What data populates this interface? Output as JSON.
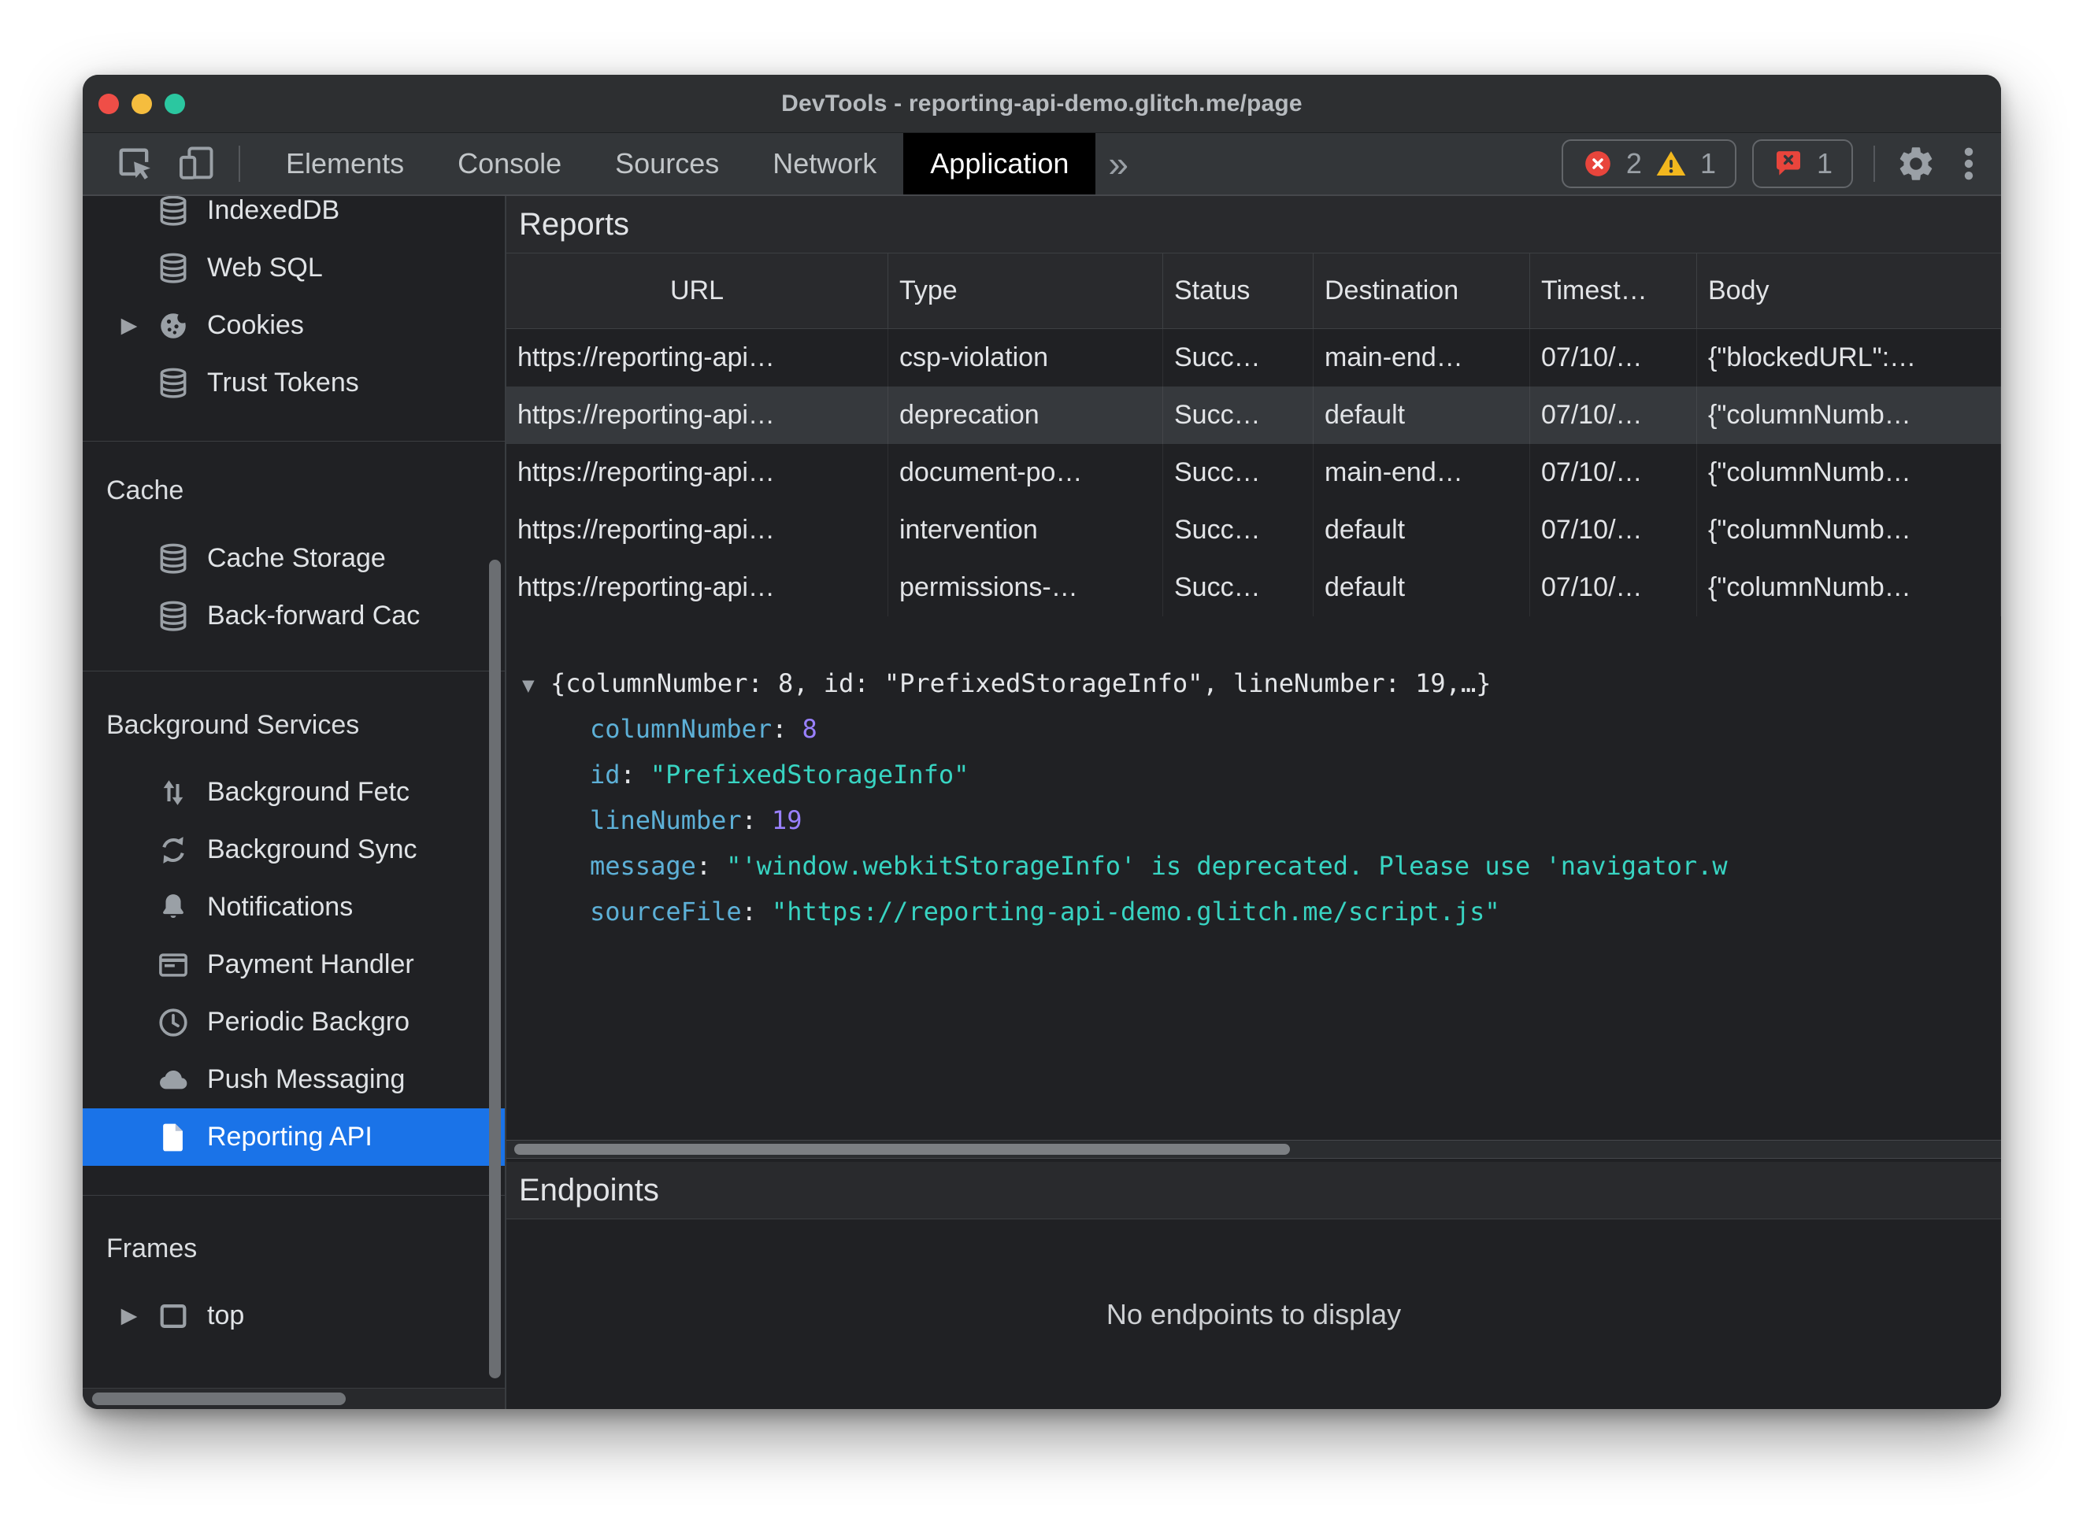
{
  "window": {
    "title": "DevTools - reporting-api-demo.glitch.me/page"
  },
  "toolbar": {
    "tabs": [
      {
        "label": "Elements",
        "selected": false
      },
      {
        "label": "Console",
        "selected": false
      },
      {
        "label": "Sources",
        "selected": false
      },
      {
        "label": "Network",
        "selected": false
      },
      {
        "label": "Application",
        "selected": true
      }
    ],
    "more_tabs_glyph": "»",
    "badges": {
      "errors": "2",
      "warnings": "1",
      "issues": "1"
    }
  },
  "sidebar": {
    "expander_glyph": "▶",
    "items": [
      {
        "label": "IndexedDB",
        "icon": "database-icon"
      },
      {
        "label": "Web SQL",
        "icon": "database-icon"
      },
      {
        "label": "Cookies",
        "icon": "cookie-icon",
        "expander": true
      },
      {
        "label": "Trust Tokens",
        "icon": "database-icon"
      },
      {
        "label": "Cache",
        "type": "section-header"
      },
      {
        "label": "Cache Storage",
        "icon": "database-icon"
      },
      {
        "label": "Back-forward Cac",
        "icon": "database-icon"
      },
      {
        "label": "Background Services",
        "type": "section-header"
      },
      {
        "label": "Background Fetc",
        "icon": "fetch-arrows-icon"
      },
      {
        "label": "Background Sync",
        "icon": "sync-icon"
      },
      {
        "label": "Notifications",
        "icon": "bell-icon"
      },
      {
        "label": "Payment Handler",
        "icon": "card-icon"
      },
      {
        "label": "Periodic Backgro",
        "icon": "clock-icon"
      },
      {
        "label": "Push Messaging",
        "icon": "cloud-icon"
      },
      {
        "label": "Reporting API",
        "icon": "document-icon",
        "selected": true
      },
      {
        "label": "Frames",
        "type": "section-header"
      },
      {
        "label": "top",
        "icon": "frame-icon",
        "expander": true
      }
    ]
  },
  "reports": {
    "title": "Reports",
    "columns": [
      "URL",
      "Type",
      "Status",
      "Destination",
      "Timest…",
      "Body"
    ],
    "rows": [
      [
        "https://reporting-api…",
        "csp-violation",
        "Succ…",
        "main-end…",
        "07/10/…",
        "{\"blockedURL\":…"
      ],
      [
        "https://reporting-api…",
        "deprecation",
        "Succ…",
        "default",
        "07/10/…",
        "{\"columnNumb…"
      ],
      [
        "https://reporting-api…",
        "document-po…",
        "Succ…",
        "main-end…",
        "07/10/…",
        "{\"columnNumb…"
      ],
      [
        "https://reporting-api…",
        "intervention",
        "Succ…",
        "default",
        "07/10/…",
        "{\"columnNumb…"
      ],
      [
        "https://reporting-api…",
        "permissions-…",
        "Succ…",
        "default",
        "07/10/…",
        "{\"columnNumb…"
      ]
    ],
    "selected_row_index": 1
  },
  "details": {
    "expander_glyph": "▼",
    "separator": ":",
    "preview": "{columnNumber: 8, id: \"PrefixedStorageInfo\", lineNumber: 19,…}",
    "properties": [
      {
        "key": "columnNumber",
        "value": "8",
        "type": "number"
      },
      {
        "key": "id",
        "value": "\"PrefixedStorageInfo\"",
        "type": "string"
      },
      {
        "key": "lineNumber",
        "value": "19",
        "type": "number"
      },
      {
        "key": "message",
        "value": "\"'window.webkitStorageInfo' is deprecated. Please use 'navigator.w",
        "type": "string"
      },
      {
        "key": "sourceFile",
        "value": "\"https://reporting-api-demo.glitch.me/script.js\"",
        "type": "string"
      }
    ]
  },
  "endpoints": {
    "title": "Endpoints",
    "empty_message": "No endpoints to display"
  },
  "colors": {
    "selection_blue": "#1a73e8",
    "json_key": "#5db0d7",
    "json_number": "#9980ff",
    "json_string": "#38d4c2",
    "error_red": "#e8453c",
    "warning_yellow": "#f2b71e",
    "traffic_red": "#ef4e47",
    "traffic_yellow": "#f5bd3e",
    "traffic_green": "#2bc7a0"
  }
}
